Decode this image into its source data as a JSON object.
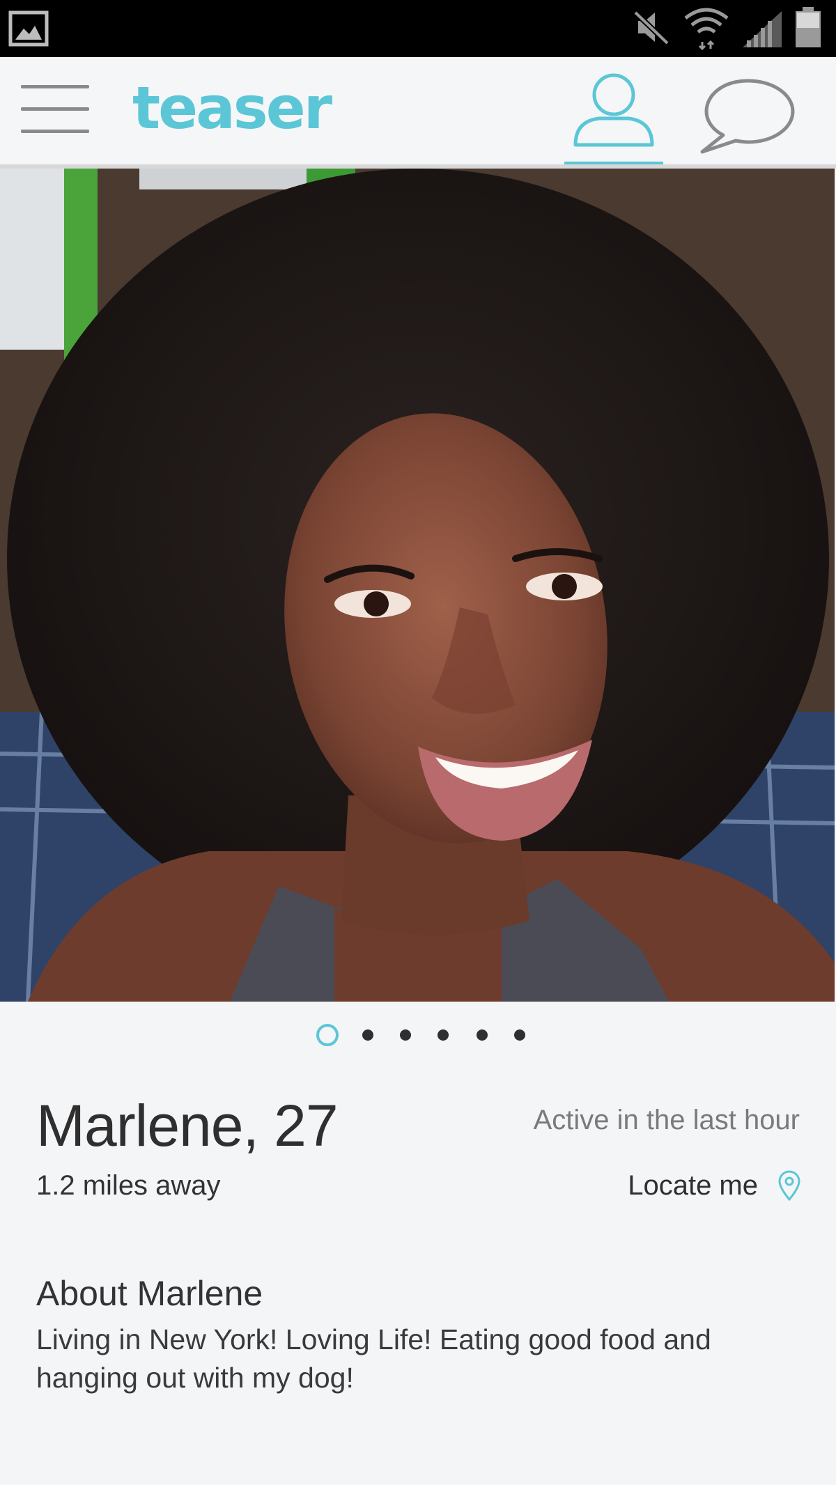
{
  "statusbar": {
    "icons": [
      "gallery-icon",
      "mute-icon",
      "wifi-icon",
      "signal-icon",
      "battery-icon"
    ]
  },
  "header": {
    "logo": "teaser",
    "tabs": [
      {
        "name": "profile",
        "icon": "person-icon",
        "active": true
      },
      {
        "name": "messages",
        "icon": "chat-bubble-icon",
        "active": false
      }
    ],
    "menu_icon": "hamburger-menu-icon"
  },
  "photo": {
    "dots_total": 6,
    "dots_active_index": 0
  },
  "profile": {
    "name": "Marlene,",
    "age": "27",
    "distance": "1.2 miles away",
    "active_status": "Active in the last hour",
    "locate_label": "Locate me",
    "about_title": "About Marlene",
    "about_text": "Living in New York! Loving Life! Eating good food and hanging out with my dog!"
  },
  "colors": {
    "accent": "#5bc6d6",
    "background": "#f4f5f7",
    "text_dark": "#2f2f2f",
    "text_muted": "#7a7a7a"
  }
}
